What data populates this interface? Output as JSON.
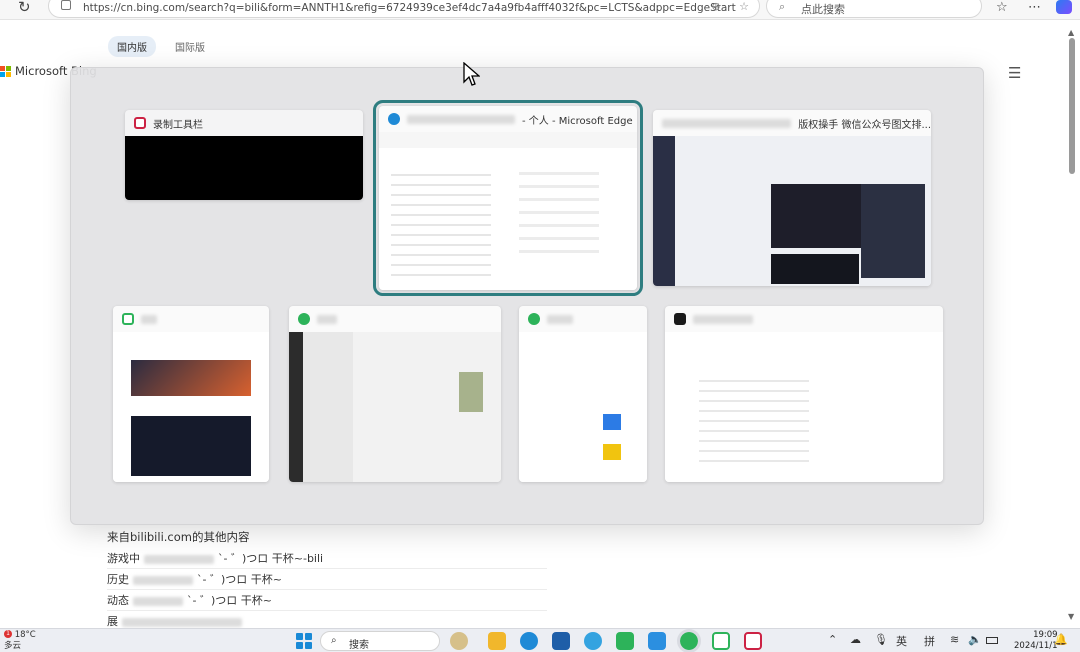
{
  "browser": {
    "url": "https://cn.bing.com/search?q=bili&form=ANNTH1&refig=6724939ce3ef4dc7a4a9fb4afff4032f&pc=LCTS&adppc=EdgeStart",
    "search_placeholder": "点此搜索"
  },
  "bing": {
    "logo_text": "Microsoft Bing",
    "tabs": [
      {
        "label": "国内版",
        "active": true
      },
      {
        "label": "国际版",
        "active": false
      }
    ]
  },
  "results": {
    "source_heading": "来自bilibili.com的其他内容",
    "lines": [
      "游戏中",
      "历史",
      "动态",
      "展"
    ],
    "line_tail": "`-  ゛)つロ 干杯~-bili",
    "line_tail2": "`-  ゛)つロ 干杯~"
  },
  "switcher": {
    "windows": [
      {
        "title": "录制工具栏",
        "icon_color": "#c24"
      },
      {
        "title": "- 个人 - Microsoft Edge",
        "icon_color": "#1f8ad6",
        "selected": true
      },
      {
        "title": "版权操手 微信公众号图文排...",
        "icon_color": "#2a7"
      },
      {
        "title": "",
        "icon_color": "#2db35a"
      },
      {
        "title": "",
        "icon_color": "#2db35a"
      },
      {
        "title": "",
        "icon_color": "#2db35a"
      },
      {
        "title": "",
        "icon_color": "#1a1a1a"
      }
    ]
  },
  "taskbar": {
    "temperature": "18°C",
    "weather": "多云",
    "badge": "1",
    "search_label": "搜索",
    "ime_lang": "英",
    "ime_mode": "拼",
    "time": "19:09",
    "date": "2024/11/1"
  }
}
